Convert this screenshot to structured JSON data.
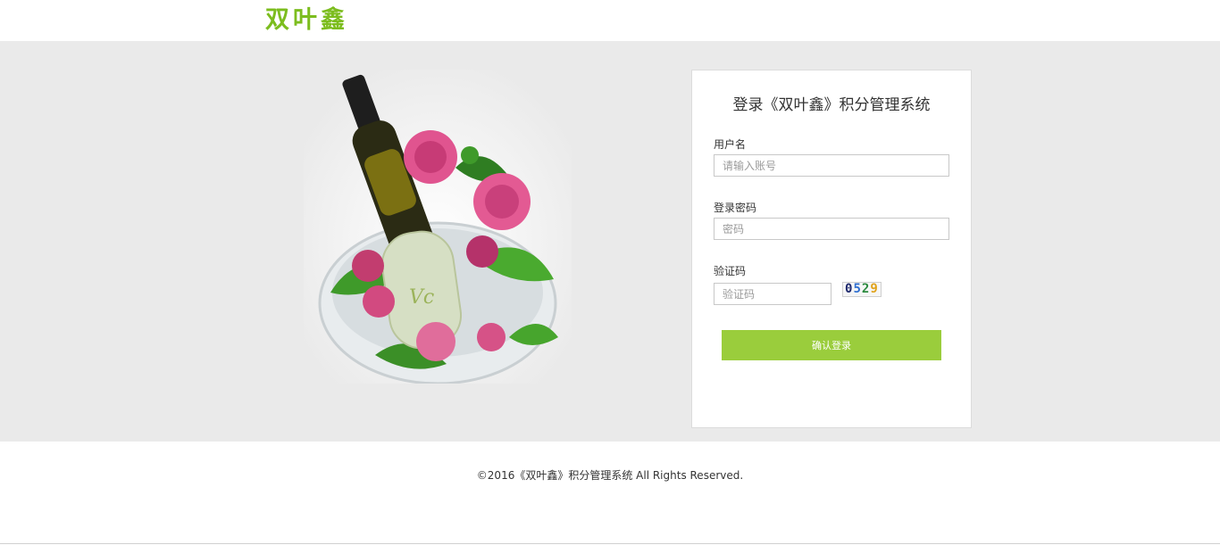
{
  "header": {
    "logo_text": "双叶鑫"
  },
  "login": {
    "title": "登录《双叶鑫》积分管理系统",
    "username_label": "用户名",
    "username_placeholder": "请输入账号",
    "password_label": "登录密码",
    "password_placeholder": "密码",
    "captcha_label": "验证码",
    "captcha_placeholder": "验证码",
    "captcha_digits": [
      {
        "char": "0",
        "color": "#1f2a6e"
      },
      {
        "char": "5",
        "color": "#2f6fd0"
      },
      {
        "char": "2",
        "color": "#2b8a3e"
      },
      {
        "char": "9",
        "color": "#e0a21a"
      }
    ],
    "submit_label": "确认登录"
  },
  "footer": {
    "copyright": "©2016《双叶鑫》积分管理系统 All Rights Reserved."
  },
  "colors": {
    "brand_green": "#7cbd1e",
    "button_green": "#9acd3c",
    "band_gray": "#eaeaea"
  }
}
